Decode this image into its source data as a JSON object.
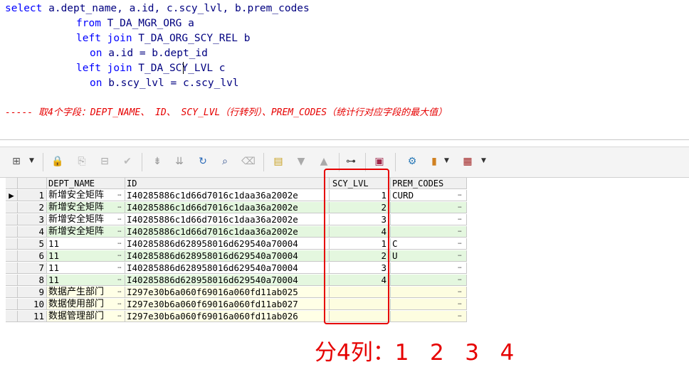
{
  "editor": {
    "lines": [
      "select a.dept_name, a.id, c.scy_lvl, b.prem_codes",
      "from T_DA_MGR_ORG a",
      "left join T_DA_ORG_SCY_REL b",
      "on a.id = b.dept_id",
      "left join T_DA_SCY_LVL c",
      "on b.scy_lvl = c.scy_lvl"
    ],
    "comment": "----- 取4个字段：DEPT_NAME、 ID、 SCY_LVL（行转列）、PREM_CODES（统计行对应字段的最大值）"
  },
  "toolbar": {
    "icons": [
      "grid-icon",
      "lock-icon",
      "add-record-icon",
      "delete-record-icon",
      "post-icon",
      "first-record-icon",
      "last-record-icon",
      "refresh-icon",
      "find-icon",
      "clear-icon",
      "save-form-icon",
      "down-icon",
      "up-icon",
      "query-icon",
      "save-icon",
      "connection-icon",
      "chart-icon",
      "table-icon"
    ]
  },
  "grid": {
    "columns": [
      "DEPT_NAME",
      "ID",
      "SCY_LVL",
      "PREM_CODES"
    ],
    "rows": [
      {
        "num": "1",
        "dept": "新增安全矩阵",
        "id": "I40285886c1d66d7016c1daa36a2002e",
        "lvl": "1",
        "prem": "CURD"
      },
      {
        "num": "2",
        "dept": "新增安全矩阵",
        "id": "I40285886c1d66d7016c1daa36a2002e",
        "lvl": "2",
        "prem": ""
      },
      {
        "num": "3",
        "dept": "新增安全矩阵",
        "id": "I40285886c1d66d7016c1daa36a2002e",
        "lvl": "3",
        "prem": ""
      },
      {
        "num": "4",
        "dept": "新增安全矩阵",
        "id": "I40285886c1d66d7016c1daa36a2002e",
        "lvl": "4",
        "prem": ""
      },
      {
        "num": "5",
        "dept": "11",
        "id": "I40285886d628958016d629540a70004",
        "lvl": "1",
        "prem": "C"
      },
      {
        "num": "6",
        "dept": "11",
        "id": "I40285886d628958016d629540a70004",
        "lvl": "2",
        "prem": "U"
      },
      {
        "num": "7",
        "dept": "11",
        "id": "I40285886d628958016d629540a70004",
        "lvl": "3",
        "prem": ""
      },
      {
        "num": "8",
        "dept": "11",
        "id": "I40285886d628958016d629540a70004",
        "lvl": "4",
        "prem": ""
      },
      {
        "num": "9",
        "dept": "数据产生部门",
        "id": "I297e30b6a060f69016a060fd11ab025",
        "lvl": "",
        "prem": ""
      },
      {
        "num": "10",
        "dept": "数据使用部门",
        "id": "I297e30b6a060f69016a060fd11ab027",
        "lvl": "",
        "prem": ""
      },
      {
        "num": "11",
        "dept": "数据管理部门",
        "id": "I297e30b6a060f69016a060fd11ab026",
        "lvl": "",
        "prem": ""
      }
    ],
    "ellipsis": "⋯",
    "current_row_marker": "▶"
  },
  "annotation": "分4列：1   2   3   4",
  "colors": {
    "accent_red": "#e60000",
    "sql_keyword": "#0000ff",
    "sql_text": "#000080",
    "row_alt": "#e4f7df"
  }
}
